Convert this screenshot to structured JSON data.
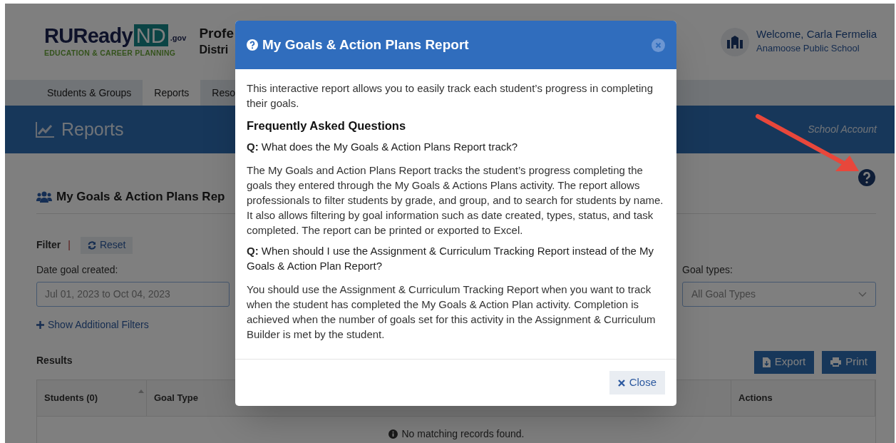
{
  "header": {
    "logo": {
      "brand": "RUReady",
      "state": "ND",
      "domain": ".gov",
      "tagline": "EDUCATION & CAREER PLANNING"
    },
    "title": "Profe",
    "subtitle": "Distri",
    "user": {
      "welcome": "Welcome, Carla Fermelia",
      "school": "Anamoose Public School"
    }
  },
  "nav": [
    {
      "label": "Students & Groups",
      "selected": false
    },
    {
      "label": "Reports",
      "selected": true
    },
    {
      "label": "Reso",
      "selected": false
    }
  ],
  "banner": {
    "title": "Reports",
    "account": "School Account"
  },
  "report": {
    "heading": "My Goals & Action Plans Rep",
    "filter_label": "Filter",
    "separator": "|",
    "reset": "Reset",
    "date_label": "Date goal created:",
    "date_value": "Jul 01, 2023 to Oct 04, 2023",
    "goal_types_label": "Goal types:",
    "goal_types_value": "All Goal Types",
    "more_filters": "Show Additional Filters",
    "results_label": "Results",
    "export": "Export",
    "print": "Print",
    "columns": [
      {
        "label": "Students (0)",
        "sortable": true
      },
      {
        "label": "Goal Type",
        "sortable": false
      },
      {
        "label": "Actions",
        "sortable": false
      }
    ],
    "empty": "No matching records found."
  },
  "modal": {
    "title": "My Goals & Action Plans Report",
    "intro": "This interactive report allows you to easily track each student’s progress in completing their goals.",
    "faq_heading": "Frequently Asked Questions",
    "items": [
      {
        "kind": "question",
        "text": "**Q:** What does the My Goals & Action Plans Report track?"
      },
      {
        "kind": "answer",
        "text": "The My Goals and Action Plans Report tracks the student’s progress completing the goals they entered through the My Goals & Actions Plans activity. The report allows professionals to filter students by grade, and group, and to search for students by name. It also allows filtering by goal information such as date created, types, status, and task completed. The report can be printed or exported to Excel."
      },
      {
        "kind": "question",
        "text": "**Q:** When should I use the Assignment & Curriculum Tracking Report instead of the My Goals & Action Plan Report?"
      },
      {
        "kind": "answer",
        "text": "You should use the Assignment & Curriculum Tracking Report when you want to track when the student has completed the My Goals & Action Plan activity. Completion is achieved when the number of goals set for this activity in the Assignment & Curriculum Builder is met by the student."
      }
    ],
    "close": "Close"
  }
}
